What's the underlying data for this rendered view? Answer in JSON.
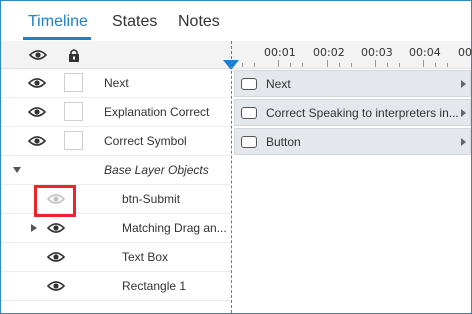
{
  "tabs": [
    {
      "label": "Timeline",
      "active": true
    },
    {
      "label": "States",
      "active": false
    },
    {
      "label": "Notes",
      "active": false
    }
  ],
  "header": {
    "visibility_icon": "eye-icon",
    "lock_icon": "lock-icon"
  },
  "ruler": {
    "ticks": [
      "00:01",
      "00:02",
      "00:03",
      "00:04",
      "00"
    ]
  },
  "layers": [
    {
      "name": "Next",
      "visible": true,
      "locked": false
    },
    {
      "name": "Explanation Correct",
      "visible": true,
      "locked": false
    },
    {
      "name": "Correct Symbol",
      "visible": true,
      "locked": false
    },
    {
      "name": "Base Layer Objects",
      "group": true
    },
    {
      "name": "btn-Submit",
      "visible": false
    },
    {
      "name": "Matching Drag an...",
      "visible": true,
      "expandable": true
    },
    {
      "name": "Text Box",
      "visible": true
    },
    {
      "name": "Rectangle 1",
      "visible": true
    }
  ],
  "timeline_tracks": [
    {
      "label": "Next"
    },
    {
      "label": "Correct Speaking to interpreters in..."
    },
    {
      "label": "Button"
    }
  ],
  "colors": {
    "accent": "#1f80c8",
    "highlight": "#e8262c",
    "track_bg": "#e4e7eb"
  }
}
